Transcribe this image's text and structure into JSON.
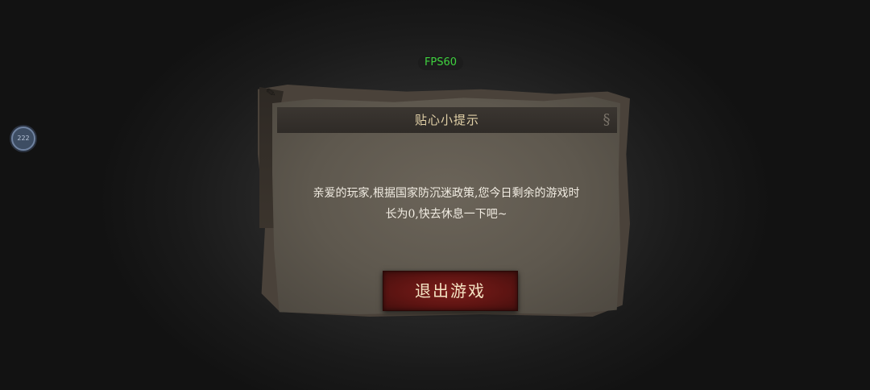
{
  "overlay": {
    "fps_label": "FPS60",
    "float_ball_label": "222"
  },
  "dialog": {
    "title": "贴心小提示",
    "message_line1": "亲爱的玩家,根据国家防沉迷政策,您今日剩余的游戏时",
    "message_line2": "长为0,快去休息一下吧~",
    "exit_button_label": "退出游戏"
  },
  "colors": {
    "fps_text": "#3fd23f",
    "button_red": "#6a1715",
    "title_text": "#e2d1a8"
  }
}
